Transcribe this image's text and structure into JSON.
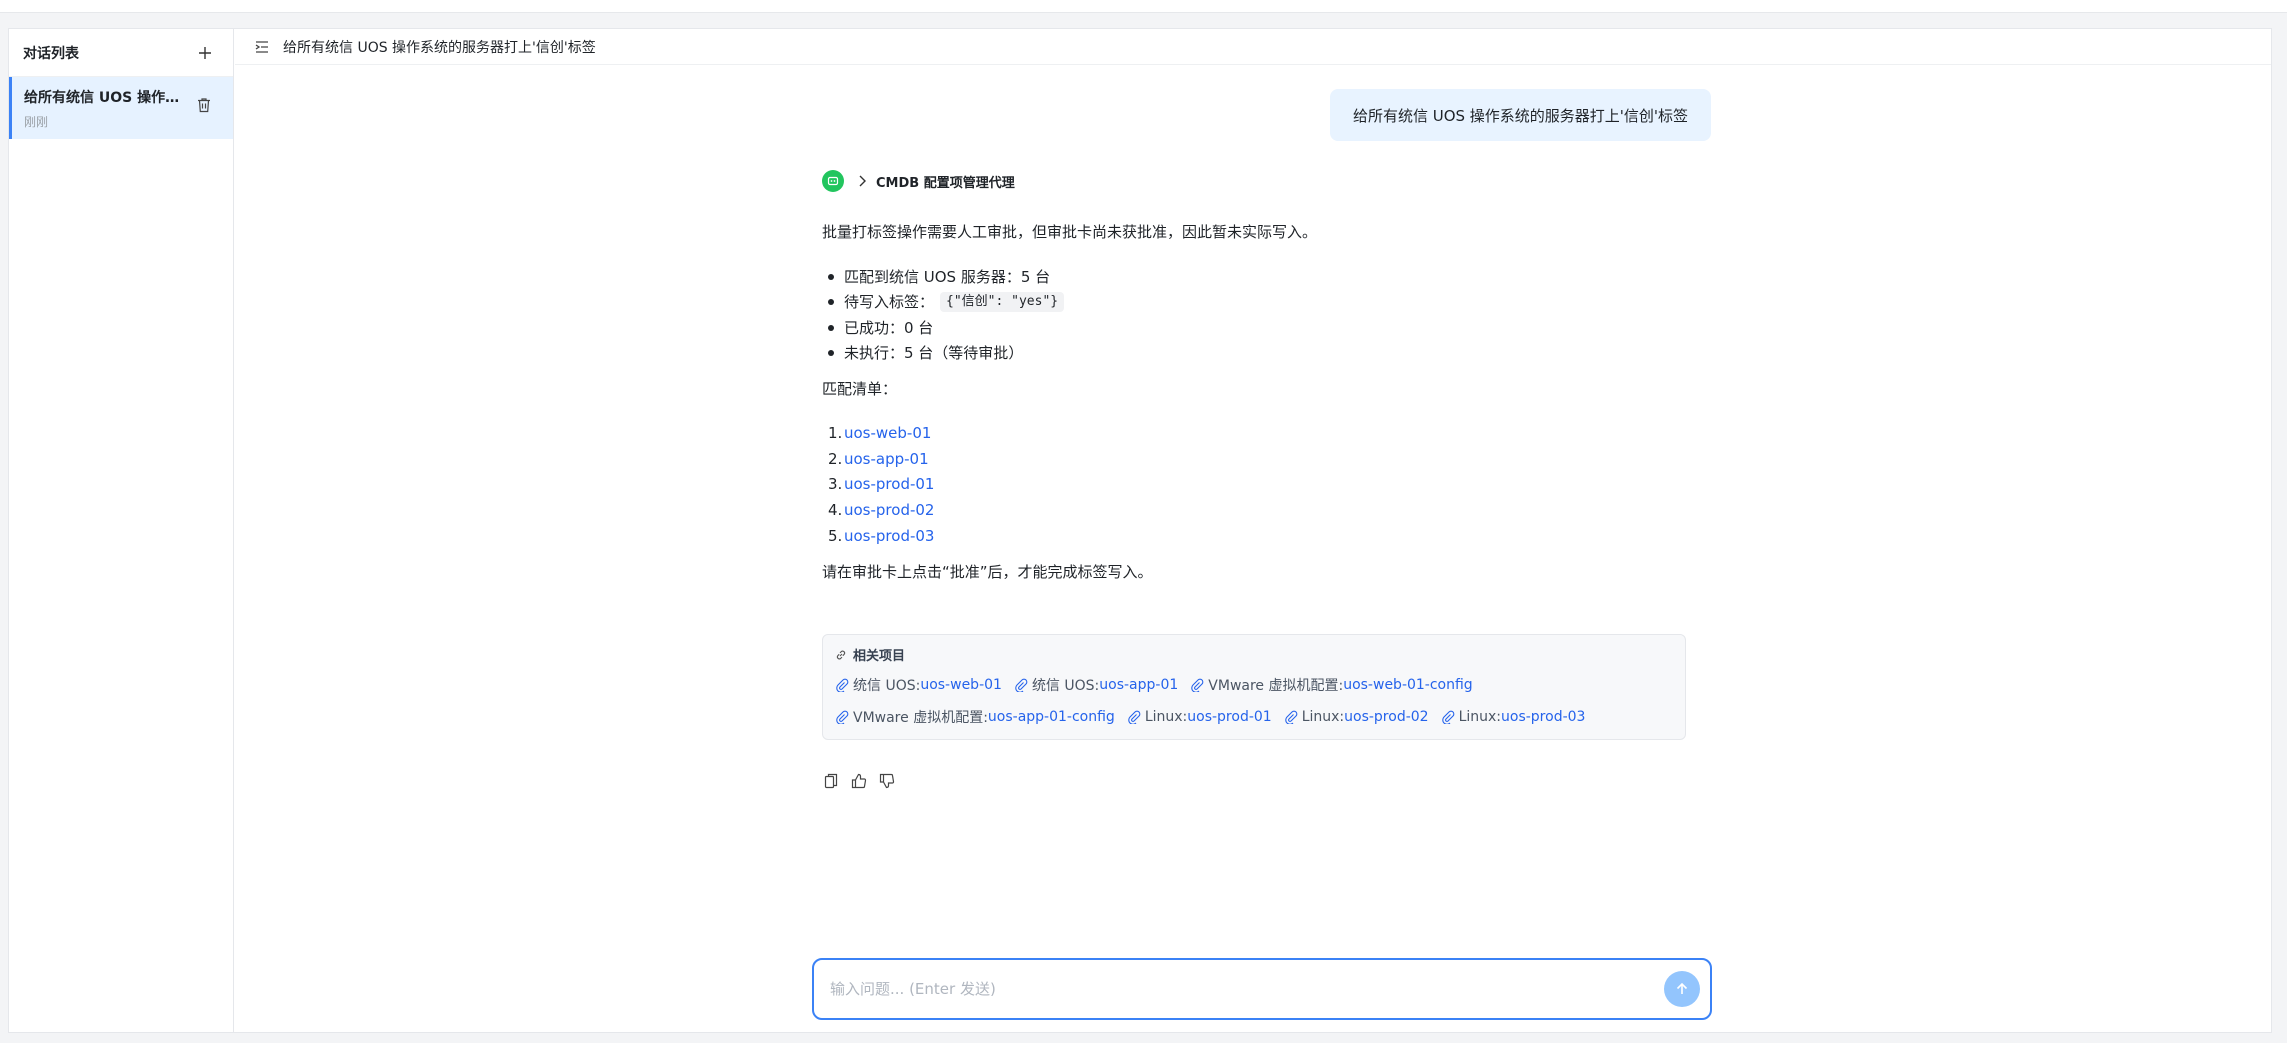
{
  "sidebar": {
    "title": "对话列表",
    "conversations": [
      {
        "title": "给所有统信 UOS 操作系统的服务器打上'信创'标签",
        "time": "刚刚"
      }
    ]
  },
  "header": {
    "title": "给所有统信 UOS 操作系统的服务器打上'信创'标签"
  },
  "user_message": "给所有统信 UOS 操作系统的服务器打上'信创'标签",
  "agent": {
    "name": "CMDB 配置项管理代理"
  },
  "answer": {
    "intro": "批量打标签操作需要人工审批，但审批卡尚未获批准，因此暂未实际写入。",
    "bullets": [
      "匹配到统信 UOS 服务器：5 台",
      "待写入标签：",
      "已成功：0 台",
      "未执行：5 台（等待审批）"
    ],
    "tag_code": "{\"信创\": \"yes\"}",
    "list_title": "匹配清单：",
    "items": [
      {
        "num": "1.",
        "name": "uos-web-01"
      },
      {
        "num": "2.",
        "name": "uos-app-01"
      },
      {
        "num": "3.",
        "name": "uos-prod-01"
      },
      {
        "num": "4.",
        "name": "uos-prod-02"
      },
      {
        "num": "5.",
        "name": "uos-prod-03"
      }
    ],
    "outro": "请在审批卡上点击“批准”后，才能完成标签写入。"
  },
  "related": {
    "title": "相关项目",
    "row1": [
      {
        "type": "统信 UOS: ",
        "name": "uos-web-01"
      },
      {
        "type": "统信 UOS: ",
        "name": "uos-app-01"
      },
      {
        "type": "VMware 虚拟机配置: ",
        "name": "uos-web-01-config"
      }
    ],
    "row2": [
      {
        "type": "VMware 虚拟机配置: ",
        "name": "uos-app-01-config"
      },
      {
        "type": "Linux: ",
        "name": "uos-prod-01"
      },
      {
        "type": "Linux: ",
        "name": "uos-prod-02"
      },
      {
        "type": "Linux: ",
        "name": "uos-prod-03"
      }
    ]
  },
  "input": {
    "placeholder": "输入问题... (Enter 发送)"
  },
  "colors": {
    "accent": "#3b82f6",
    "link": "#2563eb",
    "avatar": "#22c55e",
    "bubble": "#e8f3ff"
  }
}
